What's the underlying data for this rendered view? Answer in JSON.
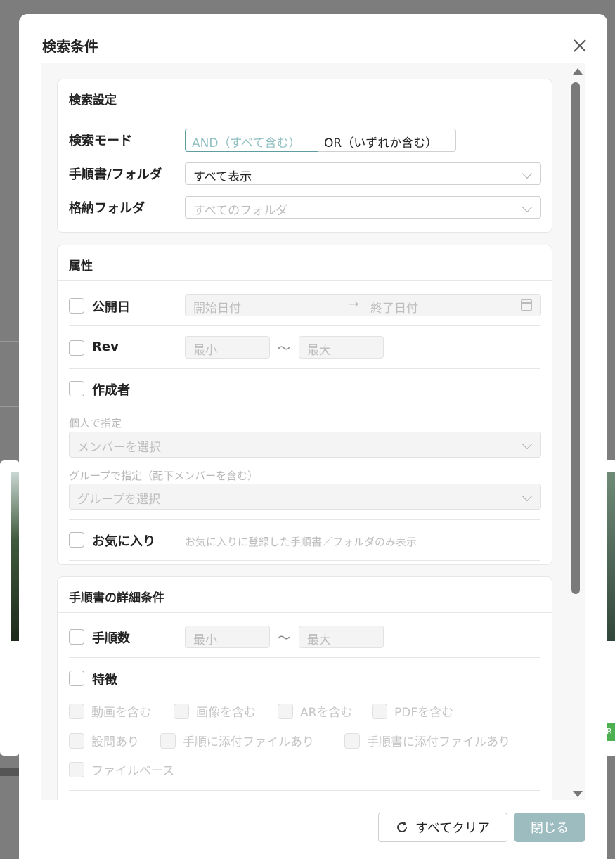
{
  "modal": {
    "title": "検索条件",
    "footer": {
      "clear_label": "すべてクリア",
      "close_label": "閉じる"
    }
  },
  "search_settings": {
    "heading": "検索設定",
    "mode_label": "検索モード",
    "mode_options": [
      "AND（すべて含む）",
      "OR（いずれか含む）"
    ],
    "mode_selected": "AND（すべて含む）",
    "manual_folder_label": "手順書/フォルダ",
    "manual_folder_value": "すべて表示",
    "storage_folder_label": "格納フォルダ",
    "storage_folder_placeholder": "すべてのフォルダ"
  },
  "attributes": {
    "heading": "属性",
    "publish_date_label": "公開日",
    "start_date_placeholder": "開始日付",
    "date_arrow": "→",
    "end_date_placeholder": "終了日付",
    "rev_label": "Rev",
    "rev_min_placeholder": "最小",
    "rev_max_placeholder": "最大",
    "range_sep": "〜",
    "author_label": "作成者",
    "individual_label": "個人で指定",
    "member_placeholder": "メンバーを選択",
    "group_label": "グループで指定（配下メンバーを含む）",
    "group_placeholder": "グループを選択",
    "favorite_label": "お気に入り",
    "favorite_hint": "お気に入りに登録した手順書／フォルダのみ表示"
  },
  "manual_details": {
    "heading": "手順書の詳細条件",
    "steps_label": "手順数",
    "steps_min_placeholder": "最小",
    "steps_max_placeholder": "最大",
    "features_label": "特徴",
    "features": [
      "動画を含む",
      "画像を含む",
      "ARを含む",
      "PDFを含む",
      "設問あり",
      "手順に添付ファイルあり",
      "手順書に添付ファイルあり",
      "ファイルベース"
    ]
  },
  "background": {
    "tag_letter": "R"
  }
}
